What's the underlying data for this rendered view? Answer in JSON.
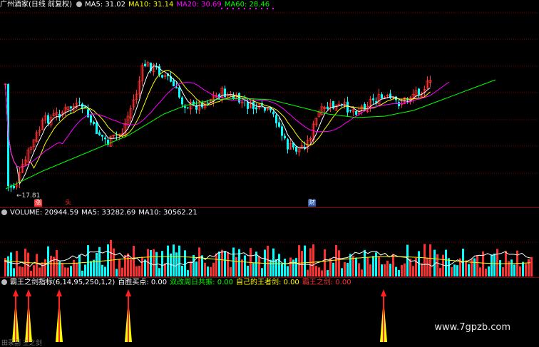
{
  "app": {
    "stock_title": "广州酒家(日线 前复权)",
    "watermark": "www.7gpzb.com",
    "footer_label": "田录副 王之剑"
  },
  "price_panel": {
    "ma_labels": [
      {
        "text": "MA5: 31.02",
        "color": "#ffffff"
      },
      {
        "text": "MA10: 31.14",
        "color": "#ffff00"
      },
      {
        "text": "MA20: 30.69",
        "color": "#ff00ff"
      },
      {
        "text": "MA60: 28.46",
        "color": "#00ff00"
      }
    ],
    "low_marker": "17.81",
    "badges": [
      {
        "text": "涨",
        "bg": "#ff3030",
        "color": "#ffffff"
      },
      {
        "text": "头",
        "bg": "#000000",
        "color": "#ff3030"
      },
      {
        "text": "财",
        "bg": "#2a5aa8",
        "color": "#ffffff"
      }
    ]
  },
  "volume_panel": {
    "labels": [
      {
        "text": "VOLUME: 20944.59",
        "color": "#ffffff"
      },
      {
        "text": "MA5: 33282.69",
        "color": "#ffffff"
      },
      {
        "text": "MA10: 30562.21",
        "color": "#ffffff"
      }
    ]
  },
  "indicator_panel": {
    "labels": [
      {
        "text": "霸王之剑指标(6,14,95,250,1,2)",
        "color": "#ffffff"
      },
      {
        "text": "百胜买点: 0.00",
        "color": "#ffffff"
      },
      {
        "text": "双改周日共振: 0.00",
        "color": "#00ff00"
      },
      {
        "text": "自己的王者剑: 0.00",
        "color": "#ffff00"
      },
      {
        "text": "霸王之剑: 0.00",
        "color": "#ff3030"
      }
    ]
  },
  "colors": {
    "up": "#ff3030",
    "down": "#00ffff",
    "grid": "#8a0000",
    "ma5": "#ffffff",
    "ma10": "#ffff00",
    "ma20": "#ff00ff",
    "ma60": "#00ff00"
  }
}
